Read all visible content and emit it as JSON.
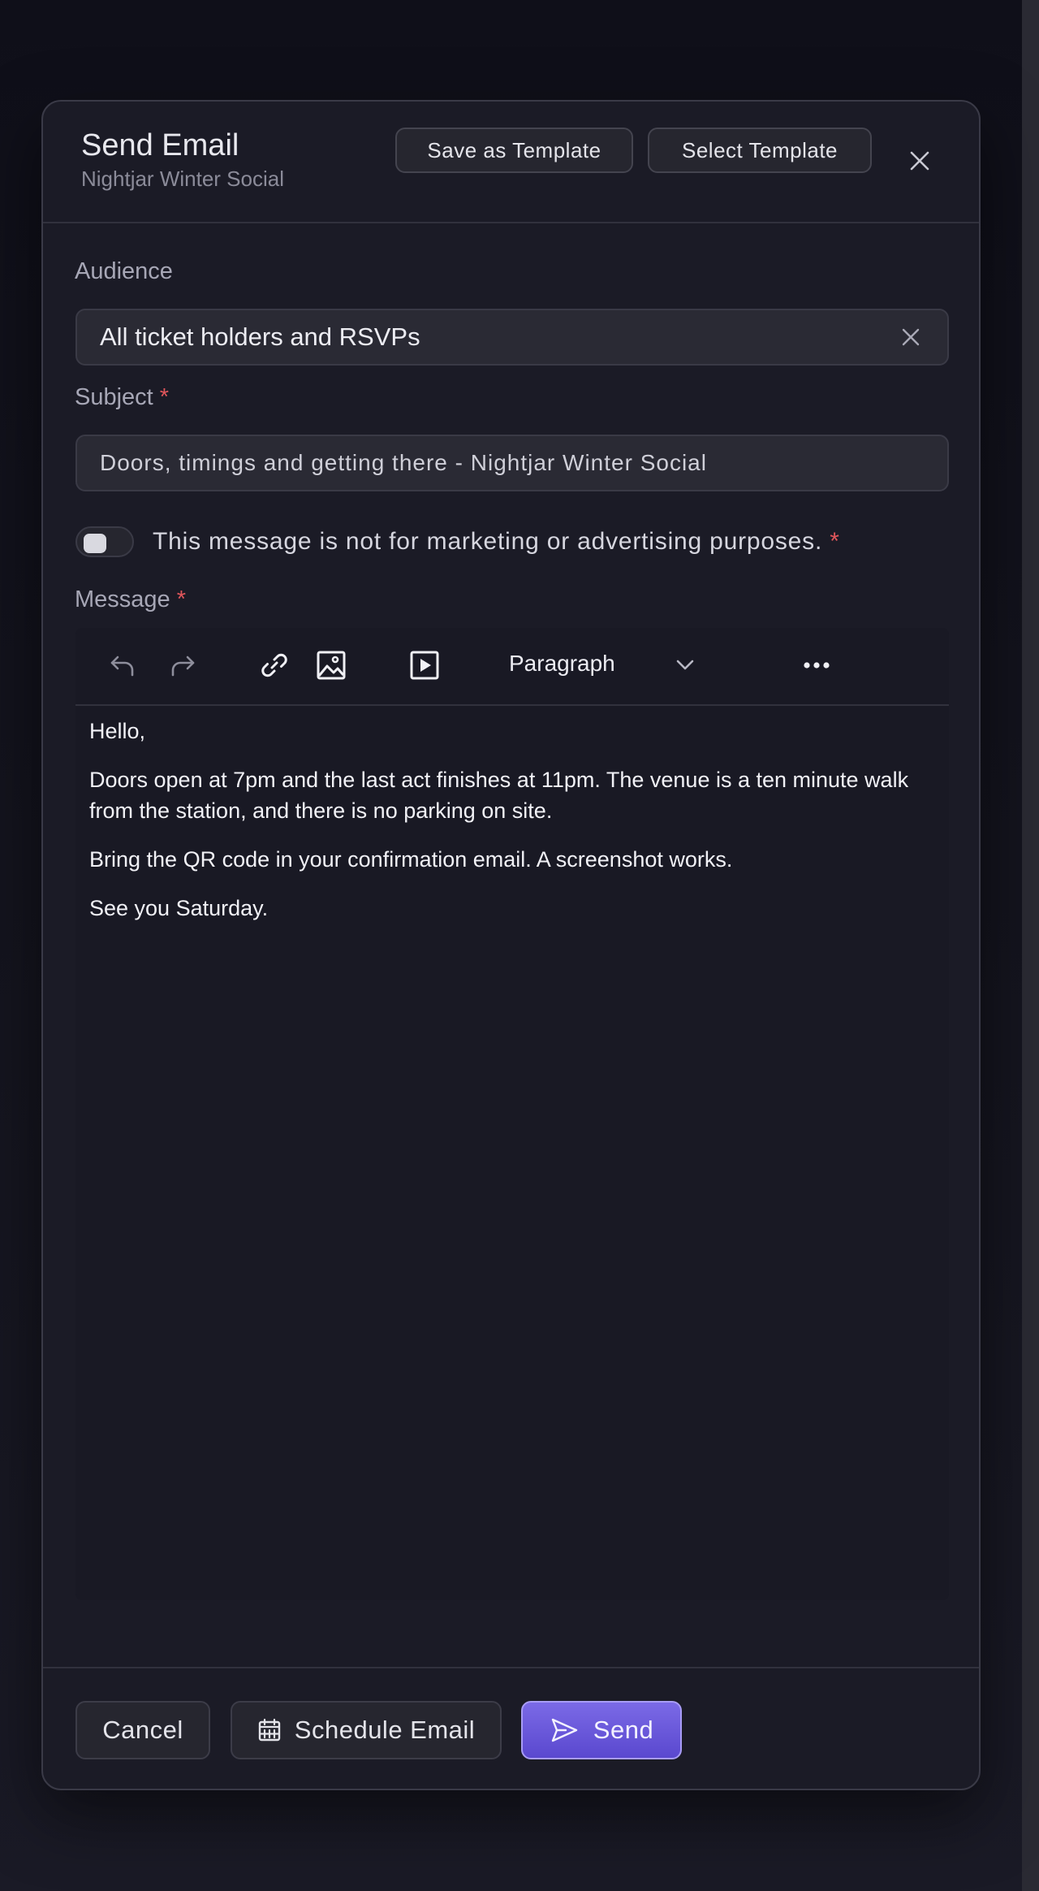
{
  "modal": {
    "title": "Send Email",
    "subtitle": "Nightjar Winter Social",
    "save_template_label": "Save as Template",
    "select_template_label": "Select Template"
  },
  "audience": {
    "label": "Audience",
    "value": "All ticket holders and RSVPs"
  },
  "subject": {
    "label": "Subject",
    "required_mark": "*",
    "value": "Doors, timings and getting there - Nightjar Winter Social"
  },
  "marketing_toggle": {
    "label": "This message is not for marketing or advertising purposes.",
    "required_mark": "*",
    "checked": false
  },
  "message": {
    "label": "Message",
    "required_mark": "*",
    "toolbar": {
      "block_type": "Paragraph",
      "icons": [
        "undo-icon",
        "redo-icon",
        "link-icon",
        "image-icon",
        "video-icon",
        "more-icon"
      ]
    },
    "paragraphs": [
      "Hello,",
      "Doors open at 7pm and the last act finishes at 11pm. The venue is a ten minute walk from the station, and there is no parking on site.",
      "Bring the QR code in your confirmation email. A screenshot works.",
      "See you Saturday."
    ]
  },
  "footer": {
    "cancel_label": "Cancel",
    "schedule_label": "Schedule Email",
    "send_label": "Send"
  },
  "colors": {
    "accent": "#6a58dc",
    "required": "#e0565b"
  }
}
